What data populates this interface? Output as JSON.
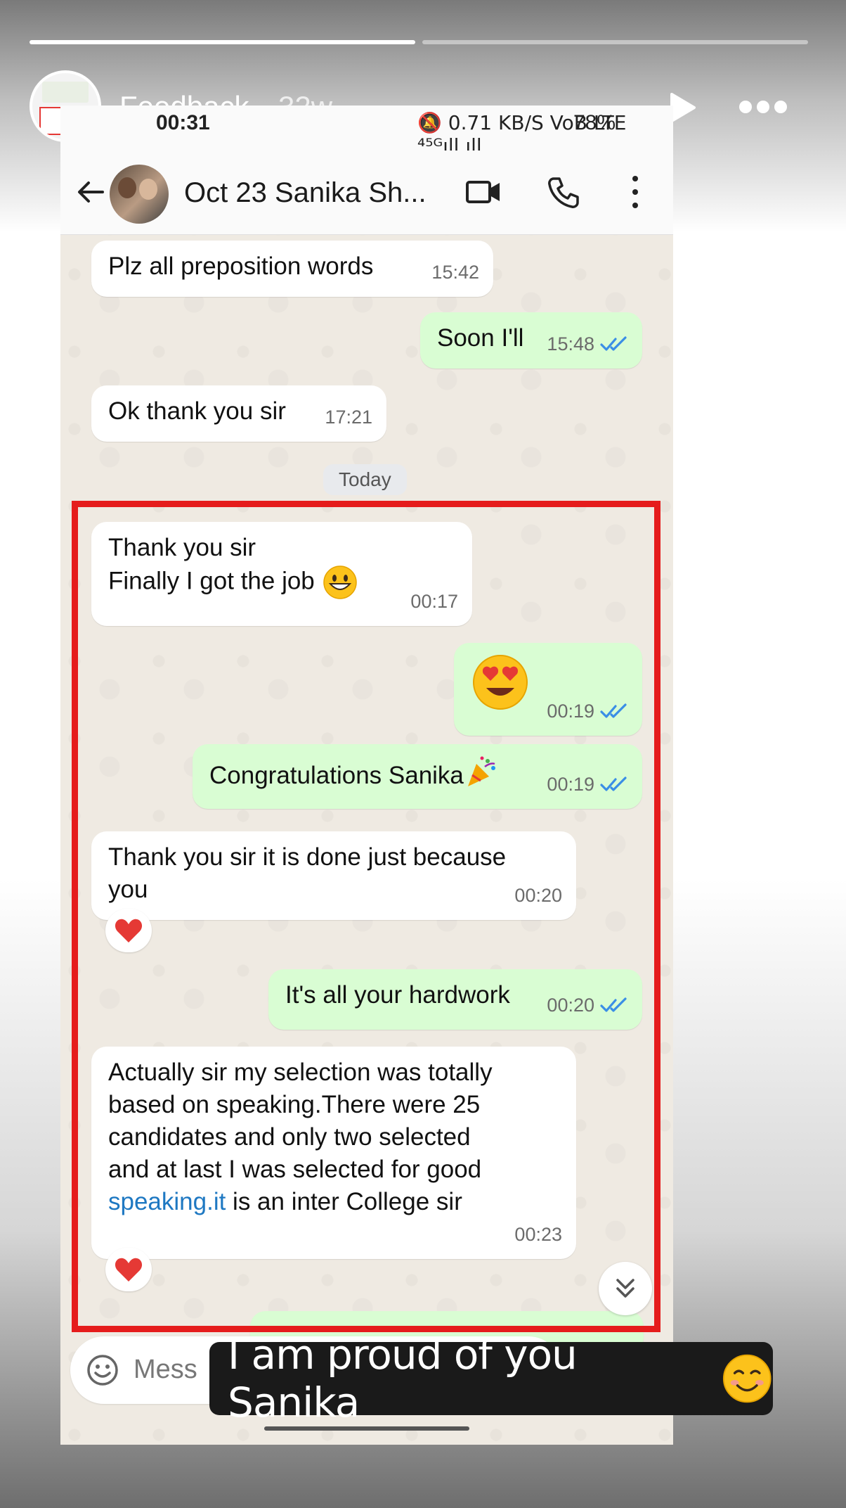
{
  "story": {
    "title": "Feedback",
    "age": "32w",
    "segments_total": 2,
    "segments_done": 1
  },
  "status_bar": {
    "time": "00:31",
    "icons": "🔕 0.71 KB/S VoB LTE ⁴⁵ᴳıll ıll",
    "battery": "78%"
  },
  "chat": {
    "contact_name": "Oct 23 Sanika Sh...",
    "day_separator": "Today",
    "messages": [
      {
        "dir": "in",
        "text": "Plz all preposition words",
        "time": "15:42"
      },
      {
        "dir": "out",
        "text": "Soon I'll",
        "time": "15:48",
        "status": "read"
      },
      {
        "dir": "in",
        "text": "Ok thank you sir",
        "time": "17:21"
      },
      {
        "dir": "in",
        "text": "Thank you sir\nFinally I got the job",
        "emoji": "grinning-face",
        "time": "00:17"
      },
      {
        "dir": "out",
        "emoji": "heart-eyes-face",
        "time": "00:19",
        "status": "read"
      },
      {
        "dir": "out",
        "text": "Congratulations Sanika",
        "emoji": "party-popper",
        "time": "00:19",
        "status": "read"
      },
      {
        "dir": "in",
        "text": "Thank you sir it is done just because\nyou",
        "time": "00:20",
        "reaction": "red-heart"
      },
      {
        "dir": "out",
        "text": "It's all your hardwork",
        "time": "00:20",
        "status": "read"
      },
      {
        "dir": "in",
        "text_before_link": "Actually sir my selection was totally\nbased on speaking.There were 25\ncandidates and only two selected\nand at last I was selected for good\n",
        "link": "speaking.it",
        "text_after_link": " is an inter College sir",
        "time": "00:23",
        "reaction": "red-heart"
      }
    ],
    "composer_placeholder": "Mess"
  },
  "caption": "I am proud of you Sanika",
  "colors": {
    "highlight_border": "#e51c1c",
    "outgoing_bubble": "#d9fdd3",
    "incoming_bubble": "#ffffff",
    "read_ticks": "#3a8ee6",
    "link": "#1e78c2"
  }
}
